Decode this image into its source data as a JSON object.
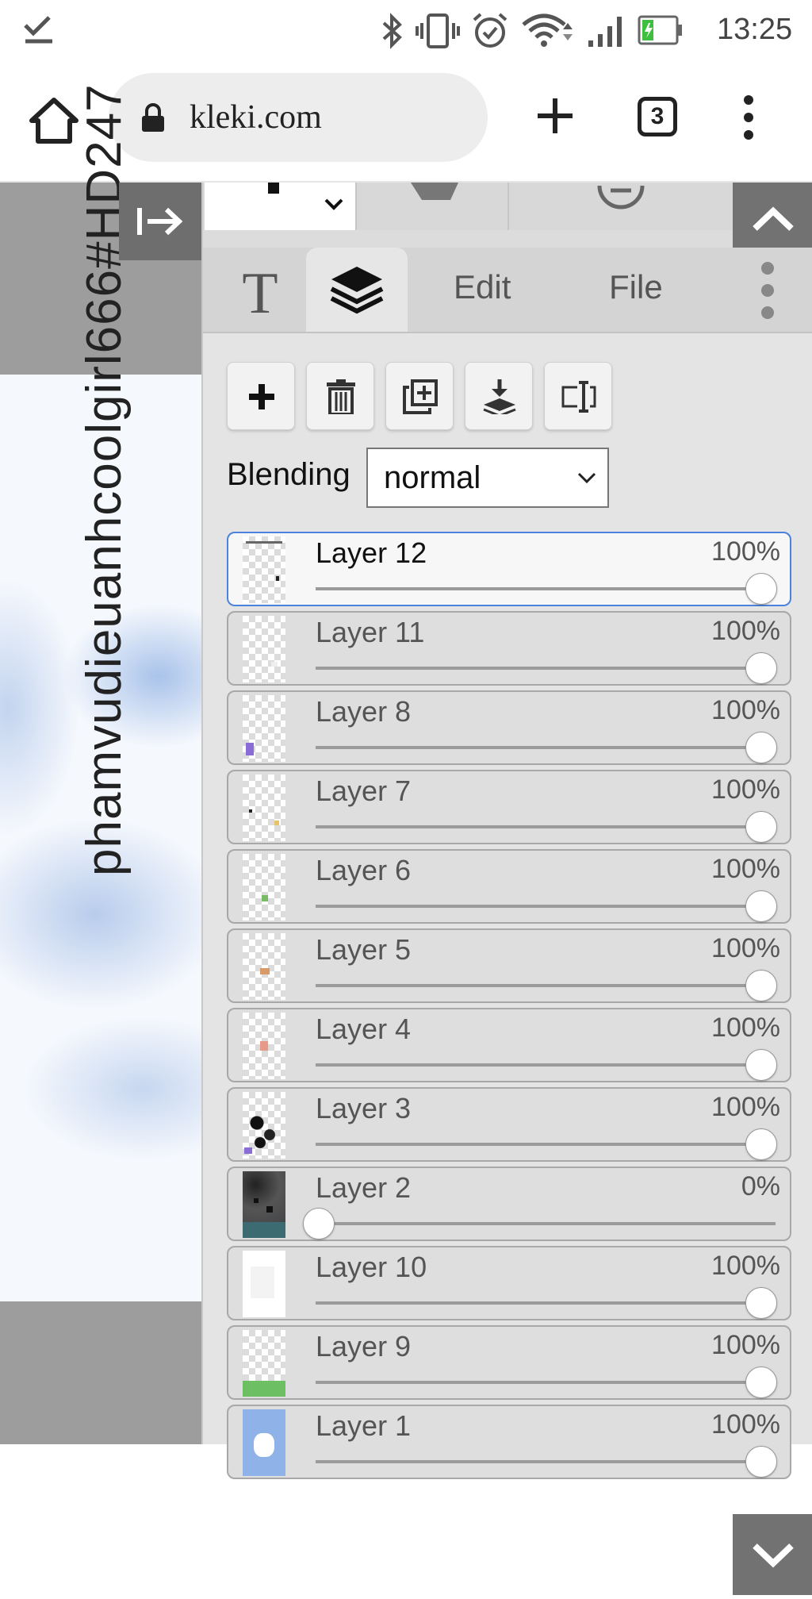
{
  "status_bar": {
    "time": "13:25",
    "icons": [
      "download-done-icon",
      "bluetooth-icon",
      "vibrate-icon",
      "alarm-icon",
      "wifi-icon",
      "signal-icon",
      "battery-icon"
    ]
  },
  "browser": {
    "url": "kleki.com",
    "tab_count": "3"
  },
  "canvas": {
    "text": "phamvudieuanhcoolgirl666#HD247"
  },
  "panel": {
    "tabs": {
      "text_tool": "T",
      "edit": "Edit",
      "file": "File"
    },
    "blending": {
      "label": "Blending",
      "value": "normal"
    },
    "layers": [
      {
        "name": "Layer 12",
        "opacity_label": "100%",
        "opacity": 100,
        "selected": true
      },
      {
        "name": "Layer 11",
        "opacity_label": "100%",
        "opacity": 100
      },
      {
        "name": "Layer 8",
        "opacity_label": "100%",
        "opacity": 100
      },
      {
        "name": "Layer 7",
        "opacity_label": "100%",
        "opacity": 100
      },
      {
        "name": "Layer 6",
        "opacity_label": "100%",
        "opacity": 100
      },
      {
        "name": "Layer 5",
        "opacity_label": "100%",
        "opacity": 100
      },
      {
        "name": "Layer 4",
        "opacity_label": "100%",
        "opacity": 100
      },
      {
        "name": "Layer 3",
        "opacity_label": "100%",
        "opacity": 100
      },
      {
        "name": "Layer 2",
        "opacity_label": "0%",
        "opacity": 0
      },
      {
        "name": "Layer 10",
        "opacity_label": "100%",
        "opacity": 100
      },
      {
        "name": "Layer 9",
        "opacity_label": "100%",
        "opacity": 100
      },
      {
        "name": "Layer 1",
        "opacity_label": "100%",
        "opacity": 100
      }
    ]
  },
  "colors": {
    "selected_border": "#4a82dd",
    "panel_bg": "#e4e4e4",
    "dark_button": "#727272"
  }
}
